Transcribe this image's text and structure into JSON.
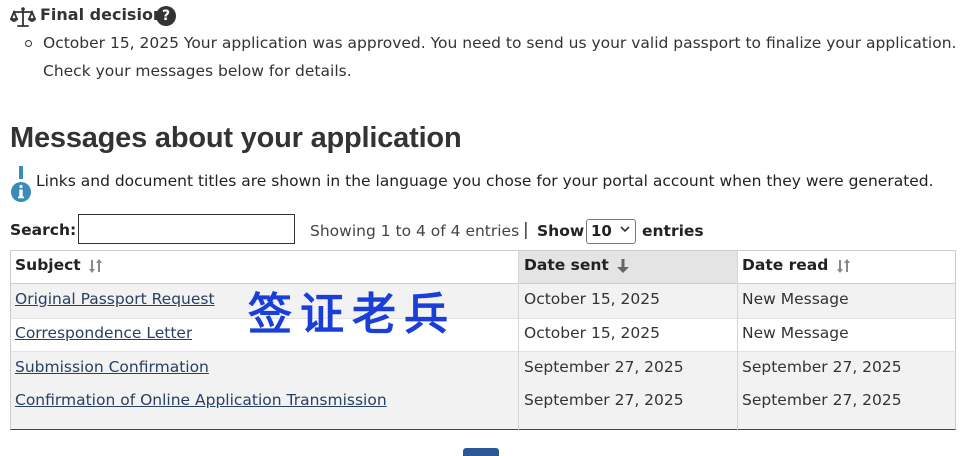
{
  "final_decision": {
    "title": "Final decision",
    "help_glyph": "?",
    "line1": "October 15, 2025 Your application was approved. You need to send us your valid passport to finalize your application.",
    "line2": "Check your messages below for details."
  },
  "messages": {
    "heading": "Messages about your application",
    "info_text": "Links and document titles are shown in the language you chose for your portal account when they were generated.",
    "search_label": "Search:",
    "search_value": "",
    "showing_text": "Showing 1 to 4 of 4 entries",
    "separator": "|",
    "show_label": "Show",
    "entries_value": "10",
    "entries_label": "entries",
    "columns": [
      "Subject",
      "Date sent",
      "Date read"
    ],
    "rows": [
      {
        "subject": "Original Passport Request",
        "date_sent": "October 15, 2025",
        "date_read": "New Message"
      },
      {
        "subject": "Correspondence Letter",
        "date_sent": "October 15, 2025",
        "date_read": "New Message"
      },
      {
        "subject": "Submission Confirmation",
        "date_sent": "September 27, 2025",
        "date_read": "September 27, 2025"
      },
      {
        "subject": "Confirmation of Online Application Transmission",
        "date_sent": "September 27, 2025",
        "date_read": "September 27, 2025"
      }
    ]
  },
  "watermark": "签证老兵",
  "colors": {
    "link": "#284162",
    "info_icon": "#3a8bb7",
    "watermark": "#1a3fd9",
    "sorted_header_bg": "#e4e4e4",
    "row_alt_bg": "#f2f2f2"
  },
  "icons": {
    "scale": "balance-scale-icon",
    "help": "question-circle-icon",
    "info": "info-icon",
    "sort": "sort-icon",
    "sort_desc": "arrow-down-icon",
    "chevron": "chevron-down-icon"
  }
}
